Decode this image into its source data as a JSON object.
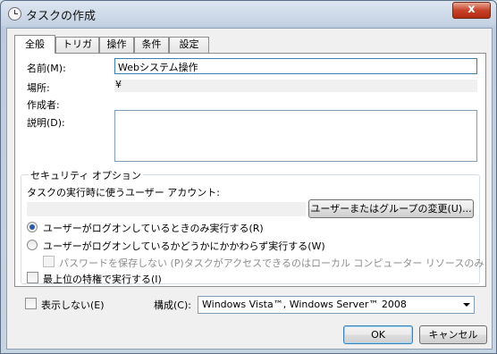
{
  "window": {
    "title": "タスクの作成",
    "close_glyph": "x"
  },
  "tabs": [
    {
      "label": "全般"
    },
    {
      "label": "トリガー"
    },
    {
      "label": "操作"
    },
    {
      "label": "条件"
    },
    {
      "label": "設定"
    }
  ],
  "general": {
    "name_label": "名前(M):",
    "name_value": "Webシステム操作",
    "location_label": "場所:",
    "location_value": "¥",
    "author_label": "作成者:",
    "author_value": "",
    "description_label": "説明(D):",
    "description_value": ""
  },
  "security": {
    "group_title": "セキュリティ オプション",
    "account_prompt": "タスクの実行時に使うユーザー アカウント:",
    "account_value": "",
    "change_user_button": "ユーザーまたはグループの変更(U)...",
    "radio_logged_on": "ユーザーがログオンしているときのみ実行する(R)",
    "radio_logged_on_selected": true,
    "radio_whether": "ユーザーがログオンしているかどうかにかかわらず実行する(W)",
    "radio_whether_selected": false,
    "no_password_check": "パスワードを保存しない (P)タスクがアクセスできるのはローカル コンピューター リソースのみ",
    "highest_privilege_check": "最上位の特権で実行する(I)"
  },
  "footer": {
    "hidden_label": "表示しない(E)",
    "configure_label": "構成(C):",
    "configure_value": "Windows Vista™, Windows Server™ 2008",
    "ok_button": "OK",
    "cancel_button": "キャンセル"
  }
}
